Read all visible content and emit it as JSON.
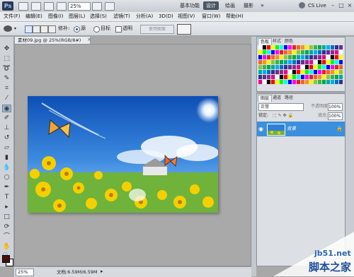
{
  "app": {
    "logo": "Ps",
    "zoom": "25%",
    "workspaces": [
      "基本功能",
      "设计",
      "绘画",
      "摄影"
    ],
    "active_workspace": "设计",
    "cs_live": "CS Live"
  },
  "menu": [
    "文件(F)",
    "编辑(E)",
    "图像(I)",
    "图层(L)",
    "选择(S)",
    "滤镜(T)",
    "分析(A)",
    "3D(D)",
    "视图(V)",
    "窗口(W)",
    "帮助(H)"
  ],
  "options": {
    "tolerance_label": "修补:",
    "source_label": "源",
    "target_label": "目标",
    "transparent_label": "透明",
    "use_pattern": "使用图案"
  },
  "document": {
    "tab_title": "素材09.jpg @ 25%(RGB/8#)",
    "close": "×"
  },
  "status": {
    "zoom": "25%",
    "doc_info": "文档:6.59M/6.59M"
  },
  "swatches_panel": {
    "tabs": [
      "色板",
      "样式",
      "颜色"
    ],
    "colors": [
      "#ffffff",
      "#000000",
      "#ff0000",
      "#ffff00",
      "#00ff00",
      "#00ffff",
      "#0000ff",
      "#ff00ff",
      "#ed1c24",
      "#f26522",
      "#f7941d",
      "#fff200",
      "#8dc63f",
      "#39b54a",
      "#00a651",
      "#00a99d",
      "#00aeef",
      "#0072bc",
      "#2e3192",
      "#662d91",
      "#92278f",
      "#ec008c"
    ]
  },
  "layers_panel": {
    "tabs": [
      "图层",
      "通道",
      "路径"
    ],
    "blend_mode": "正常",
    "opacity_label": "不透明度:",
    "opacity": "100%",
    "lock_label": "锁定:",
    "fill_label": "填充:",
    "fill": "100%",
    "layer_name": "背景"
  },
  "watermark": {
    "site": "jb51.net",
    "name": "脚本之家"
  },
  "colors": {
    "accent": "#3b8fdc",
    "canvas_bg": "#a9a9a9"
  }
}
